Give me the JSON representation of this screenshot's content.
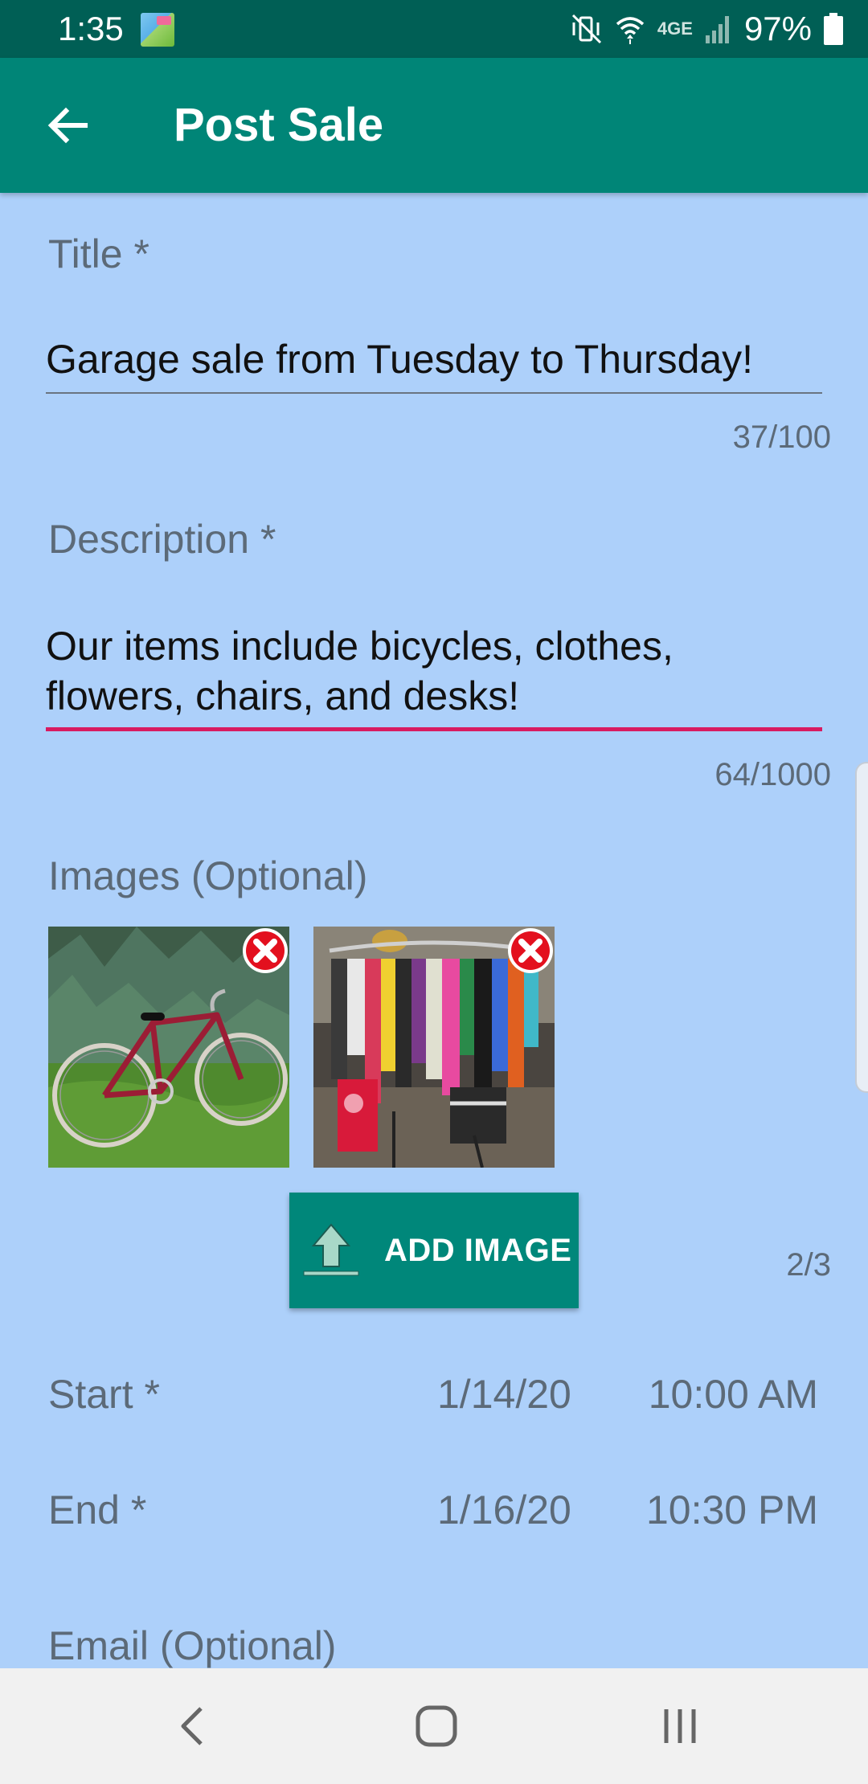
{
  "status_bar": {
    "time": "1:35",
    "battery": "97%",
    "network": "4GE",
    "icons": [
      "app-sale-icon",
      "mute-vibrate-icon",
      "wifi-icon",
      "signal-icon",
      "battery-icon"
    ]
  },
  "app_bar": {
    "title": "Post Sale",
    "back_icon": "arrow-back-icon",
    "color": "#008577"
  },
  "form": {
    "title": {
      "label": "Title *",
      "value": "Garage sale from Tuesday to Thursday!",
      "counter": "37/100"
    },
    "description": {
      "label": "Description *",
      "value": "Our items include bicycles, clothes, flowers, chairs, and desks!",
      "counter": "64/1000",
      "focused": true
    },
    "images": {
      "label": "Images (Optional)",
      "items": [
        {
          "subject": "red bicycle on grass"
        },
        {
          "subject": "clothing rack"
        }
      ],
      "remove_icon": "remove-x-icon",
      "add_button_label": "ADD IMAGE",
      "add_icon": "upload-icon",
      "counter": "2/3"
    },
    "start": {
      "label": "Start *",
      "date": "1/14/20",
      "time": "10:00 AM"
    },
    "end": {
      "label": "End *",
      "date": "1/16/20",
      "time": "10:30 PM"
    },
    "email": {
      "label": "Email (Optional)"
    }
  },
  "nav_bar": {
    "buttons": [
      "back-nav-icon",
      "home-nav-icon",
      "recents-nav-icon"
    ]
  },
  "colors": {
    "background": "#add0fa",
    "accent": "#d81b60",
    "status_bar": "#005f55",
    "button": "#00877a"
  }
}
